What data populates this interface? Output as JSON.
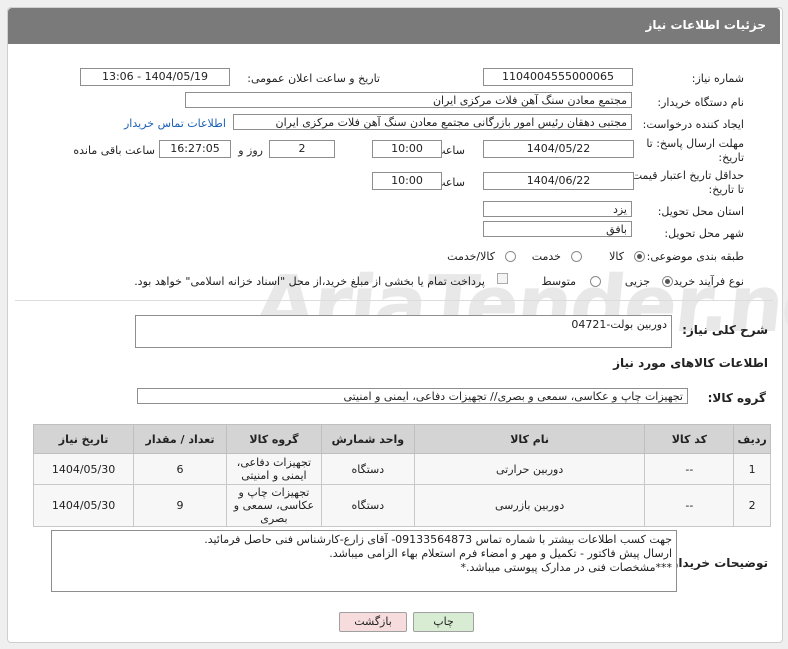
{
  "header": {
    "title": "جزئیات اطلاعات نیاز"
  },
  "fields": {
    "need_number": {
      "label": "شماره نیاز:",
      "value": "1104004555000065"
    },
    "announce_datetime": {
      "label": "تاریخ و ساعت اعلان عمومی:",
      "value": "1404/05/19 - 13:06"
    },
    "buyer_org": {
      "label": "نام دستگاه خریدار:",
      "value": "مجتمع معادن سنگ آهن فلات مرکزی ایران"
    },
    "requester": {
      "label": "ایجاد کننده درخواست:",
      "value": "مجتبی  دهقان رئیس امور بازرگانی مجتمع معادن سنگ آهن فلات مرکزی ایران",
      "contact_link": "اطلاعات تماس خریدار"
    },
    "reply_deadline": {
      "label_line1": "مهلت ارسال پاسخ: تا",
      "label_line2": "تاریخ:",
      "date": "1404/05/22",
      "time_label": "ساعت",
      "time": "10:00",
      "days_value": "2",
      "days_label": "روز و",
      "remaining": "16:27:05",
      "remaining_label": "ساعت باقی مانده"
    },
    "price_validity": {
      "label_line1": "حداقل تاریخ اعتبار قیمت:",
      "label_line2": "تا تاریخ:",
      "date": "1404/06/22",
      "time_label": "ساعت",
      "time": "10:00"
    },
    "delivery_province": {
      "label": "استان محل تحویل:",
      "value": "یزد"
    },
    "delivery_city": {
      "label": "شهر محل تحویل:",
      "value": "بافق"
    },
    "category": {
      "label": "طبقه بندی موضوعی:",
      "options": [
        "کالا",
        "خدمت",
        "کالا/خدمت"
      ],
      "selected": "کالا"
    },
    "purchase_type": {
      "label": "نوع فرآیند خرید :",
      "options": [
        "جزیی",
        "متوسط"
      ],
      "selected": "جزیی",
      "note": "پرداخت تمام یا بخشی از مبلغ خرید،از محل \"اسناد خزانه اسلامی\" خواهد بود."
    }
  },
  "description": {
    "label": "شرح کلی نیاز:",
    "value": "دوربین بولت-04721"
  },
  "goods_section": {
    "title": "اطلاعات کالاهای مورد نیاز",
    "group_label": "گروه کالا:",
    "group_value": "تجهیزات چاپ و عکاسی، سمعی و بصری// تجهیزات دفاعی، ایمنی و امنیتی"
  },
  "table": {
    "headers": [
      "ردیف",
      "کد کالا",
      "نام کالا",
      "واحد شمارش",
      "گروه کالا",
      "تعداد / مقدار",
      "تاریخ نیاز"
    ],
    "rows": [
      {
        "row": "1",
        "code": "--",
        "name": "دوربین حرارتی",
        "unit": "دستگاه",
        "group": "تجهیزات دفاعی، ایمنی و امنیتی",
        "qty": "6",
        "date": "1404/05/30"
      },
      {
        "row": "2",
        "code": "--",
        "name": "دوربین بازرسی",
        "unit": "دستگاه",
        "group": "تجهیزات چاپ و عکاسی، سمعی و بصری",
        "qty": "9",
        "date": "1404/05/30"
      }
    ]
  },
  "buyer_notes": {
    "label": "توضیحات خریدار:",
    "lines": [
      "جهت کسب اطلاعات بیشتر با شماره تماس 09133564873- آقای زارع-کارشناس فنی حاصل فرمائید.",
      "ارسال پیش فاکتور - تکمیل و مهر و امضاء فرم استعلام بهاء الزامی میباشد.",
      "***مشخصات فنی در مدارک پیوستی میباشد.*"
    ]
  },
  "buttons": {
    "print": "چاپ",
    "back": "بازگشت"
  },
  "colors": {
    "header_bg": "#7a7a7a",
    "link": "#1a5fb4",
    "print_bg": "#d8ecd3",
    "back_bg": "#f6dcdc"
  }
}
